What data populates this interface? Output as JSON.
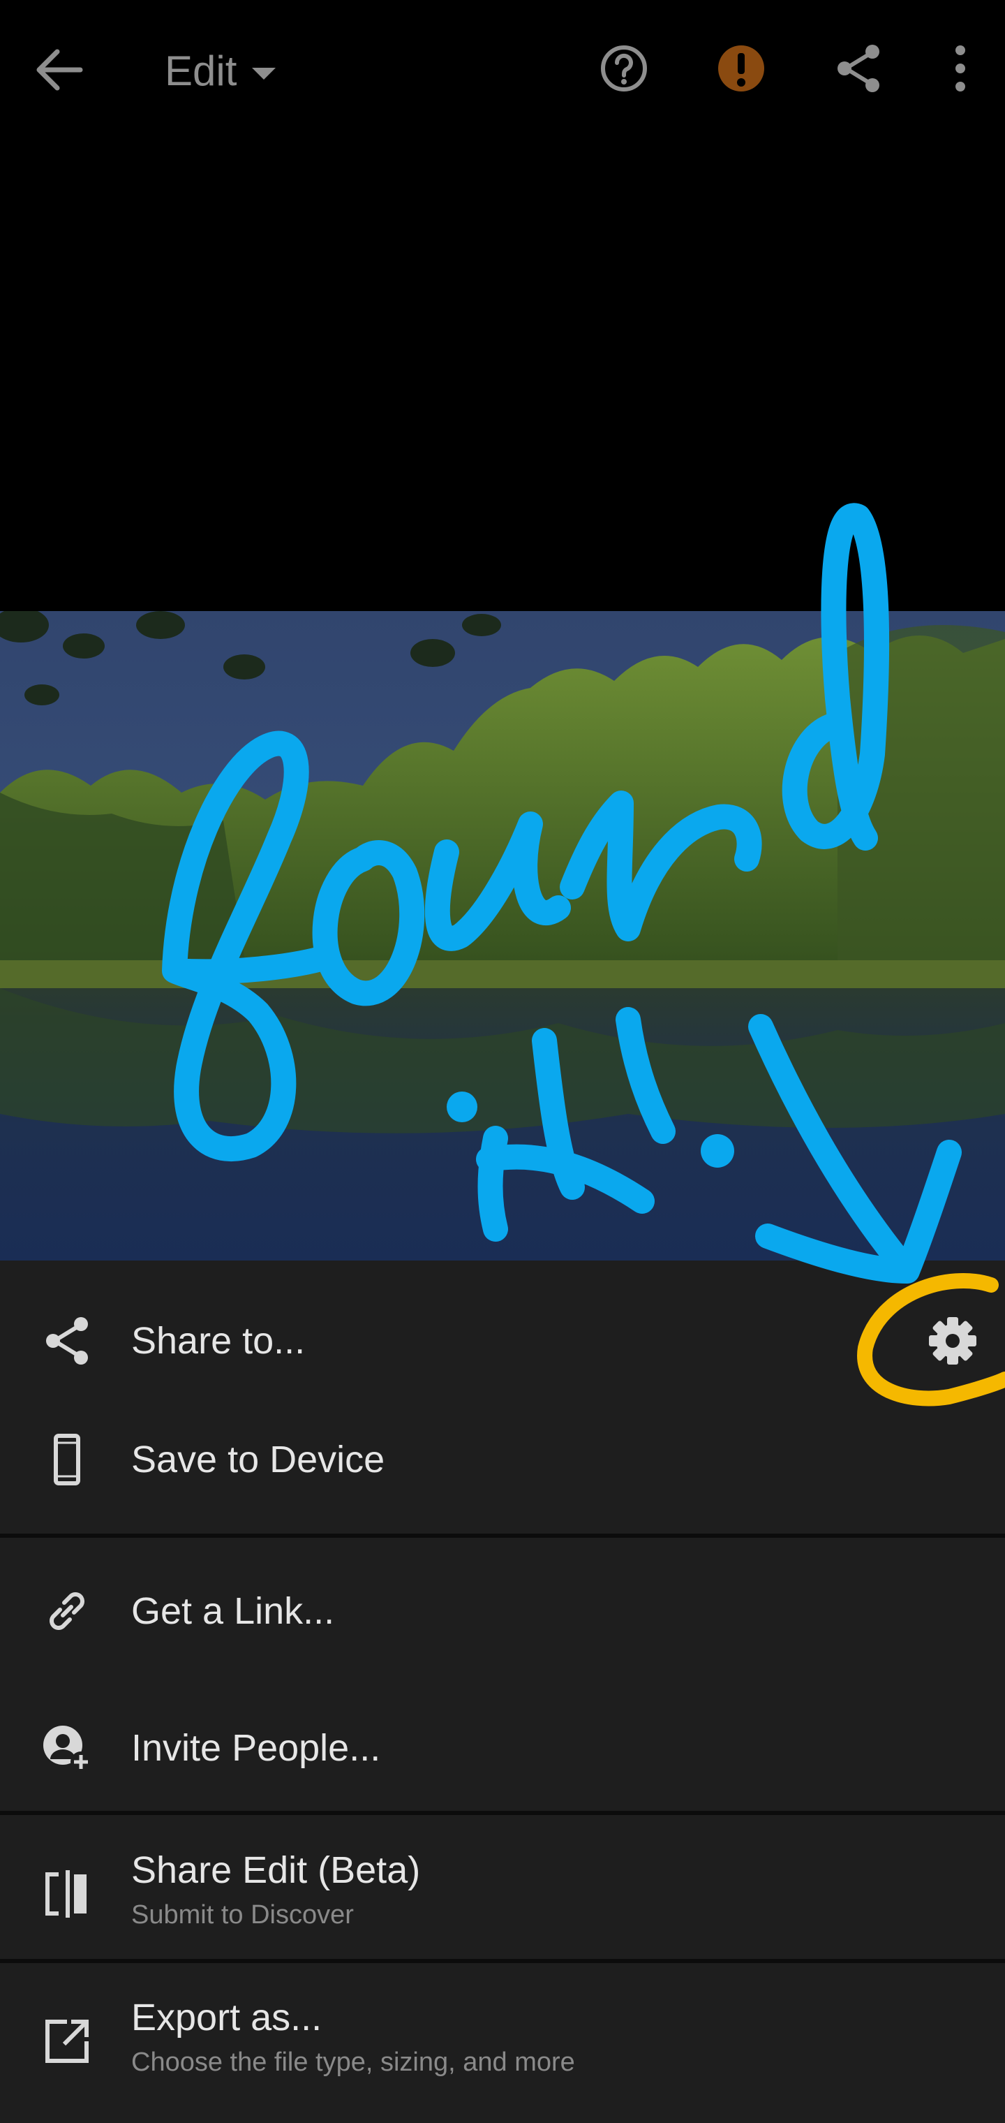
{
  "topbar": {
    "title": "Edit",
    "icons": [
      "back-arrow-icon",
      "chevron-down-icon",
      "help-icon",
      "warning-icon",
      "share-icon",
      "more-vertical-icon"
    ],
    "warning_color": "#8a4a10",
    "icon_color": "#8e8e8e"
  },
  "photo": {
    "description_icon": "landscape-photo"
  },
  "menu": {
    "items": [
      {
        "label": "Share to...",
        "icon": "share-icon"
      },
      {
        "label": "Save to Device",
        "icon": "phone-icon"
      },
      {
        "label": "Get a Link...",
        "icon": "link-icon"
      },
      {
        "label": "Invite People...",
        "icon": "invite-person-icon"
      },
      {
        "label": "Share Edit (Beta)",
        "sublabel": "Submit to Discover",
        "icon": "share-edit-icon"
      },
      {
        "label": "Export as...",
        "sublabel": "Choose the file type, sizing, and more",
        "icon": "export-icon"
      }
    ],
    "settings_icon": "gear-icon"
  },
  "annotation": {
    "handwriting": "found it!",
    "handwriting_color": "#0aa8ee",
    "circle_color": "#f5b800"
  }
}
